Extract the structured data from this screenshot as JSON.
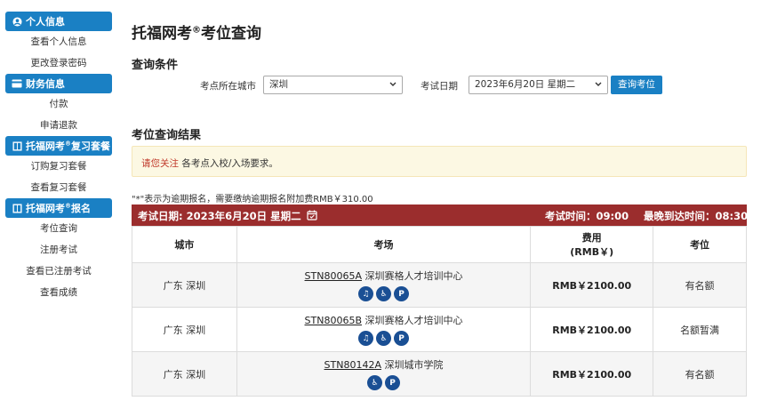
{
  "sidebar": {
    "sections": [
      {
        "title": "个人信息",
        "icon": "user-circle-icon",
        "items": [
          "查看个人信息",
          "更改登录密码"
        ]
      },
      {
        "title": "财务信息",
        "icon": "credit-card-icon",
        "items": [
          "付款",
          "申请退款"
        ]
      },
      {
        "title": "托福网考",
        "title_sup": "®",
        "title_suffix": "复习套餐",
        "icon": "book-icon",
        "items": [
          "订购复习套餐",
          "查看复习套餐"
        ]
      },
      {
        "title": "托福网考",
        "title_sup": "®",
        "title_suffix": "报名",
        "icon": "book-icon",
        "items": [
          "考位查询",
          "注册考试",
          "查看已注册考试",
          "查看成绩"
        ]
      }
    ]
  },
  "page": {
    "title_pre": "托福网考",
    "title_sup": "®",
    "title_post": "考位查询",
    "conditions_title": "查询条件",
    "city_label": "考点所在城市",
    "city_value": "深圳",
    "date_label": "考试日期",
    "date_value": "2023年6月20日 星期二",
    "search_button": "查询考位",
    "results_title": "考位查询结果",
    "notice_warn": "请您关注",
    "notice_text": " 各考点入校/入场要求。",
    "late_note": "\"*\"表示为逾期报名，需要缴纳逾期报名附加费RMB￥310.00",
    "bar_date": "考试日期:  2023年6月20日 星期二",
    "bar_test_time": "考试时间：09:00",
    "bar_latest_arrival": "最晚到达时间：08:30"
  },
  "table": {
    "headers": [
      "城市",
      "考场",
      "费用\n(RMB￥)",
      "考位"
    ],
    "fee_header_1": "费用",
    "fee_header_2": "(RMB￥)",
    "rows": [
      {
        "city": "广东 深圳",
        "code": "STN80065A",
        "name": " 深圳赛格人才培训中心",
        "fee": "RMB￥2100.00",
        "seat": "有名额",
        "icons": [
          "ear-icon",
          "wheelchair-icon",
          "parking-icon"
        ]
      },
      {
        "city": "广东 深圳",
        "code": "STN80065B",
        "name": " 深圳赛格人才培训中心",
        "fee": "RMB￥2100.00",
        "seat": "名额暂满",
        "icons": [
          "ear-icon",
          "wheelchair-icon",
          "parking-icon"
        ]
      },
      {
        "city": "广东 深圳",
        "code": "STN80142A",
        "name": " 深圳城市学院",
        "fee": "RMB￥2100.00",
        "seat": "有名额",
        "icons": [
          "wheelchair-icon",
          "parking-icon"
        ]
      }
    ]
  },
  "colors": {
    "primary": "#1a80c4",
    "bar": "#9b2d2d",
    "notice_bg": "#fcf8e3",
    "warn": "#c0392b",
    "icon_bg": "#1a4f94"
  }
}
